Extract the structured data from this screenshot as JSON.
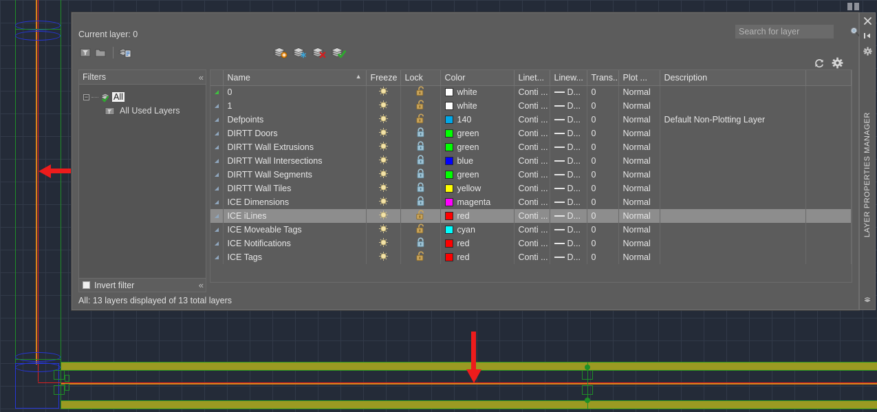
{
  "window": {
    "dock_title": "LAYER PROPERTIES MANAGER",
    "close_icon": "close-icon",
    "collapse_icon": "collapse-panel-icon",
    "settings_icon": "panel-settings-icon",
    "layers_icon": "layers-icon"
  },
  "header": {
    "current_layer_label": "Current layer: 0",
    "refresh_icon": "refresh-icon",
    "settings_icon": "gear-icon"
  },
  "search": {
    "placeholder": "Search for layer",
    "value": "",
    "icon": "search-icon"
  },
  "toolbar": {
    "left_buttons": [
      {
        "name": "new-property-filter-button",
        "icon": "filter-new-icon"
      },
      {
        "name": "new-group-filter-button",
        "icon": "folder-icon"
      },
      {
        "name": "layer-states-manager-button",
        "icon": "layer-states-icon"
      }
    ],
    "right_buttons": [
      {
        "name": "new-layer-button",
        "icon": "layer-new-icon"
      },
      {
        "name": "new-layer-vp-frozen-button",
        "icon": "layer-new-frozen-icon"
      },
      {
        "name": "delete-layer-button",
        "icon": "layer-delete-icon"
      },
      {
        "name": "set-current-button",
        "icon": "layer-set-current-icon"
      }
    ]
  },
  "filters": {
    "title": "Filters",
    "collapse_icon": "chevron-left-icon",
    "tree": [
      {
        "label": "All",
        "selected": true,
        "icon": "layers-check-icon"
      },
      {
        "label": "All Used Layers",
        "selected": false,
        "icon": "folder-used-icon"
      }
    ],
    "invert_filter_label": "Invert filter",
    "invert_filter_checked": false,
    "invert_collapse_icon": "chevron-left-icon"
  },
  "table": {
    "columns": [
      {
        "key": "status",
        "label": ""
      },
      {
        "key": "name",
        "label": "Name",
        "sorted": "asc"
      },
      {
        "key": "freeze",
        "label": "Freeze"
      },
      {
        "key": "lock",
        "label": "Lock"
      },
      {
        "key": "color",
        "label": "Color"
      },
      {
        "key": "linetype",
        "label": "Linet..."
      },
      {
        "key": "lineweight",
        "label": "Linew..."
      },
      {
        "key": "transparency",
        "label": "Trans..."
      },
      {
        "key": "plotstyle",
        "label": "Plot ..."
      },
      {
        "key": "description",
        "label": "Description"
      }
    ],
    "rows": [
      {
        "name": "0",
        "current": true,
        "freeze": "on",
        "lock": "unlocked",
        "color_name": "white",
        "color_hex": "#ffffff",
        "linetype": "Conti ...",
        "lineweight": "D...",
        "transparency": "0",
        "plotstyle": "Normal",
        "description": "",
        "selected": false
      },
      {
        "name": "1",
        "current": false,
        "freeze": "on",
        "lock": "unlocked",
        "color_name": "white",
        "color_hex": "#ffffff",
        "linetype": "Conti ...",
        "lineweight": "D...",
        "transparency": "0",
        "plotstyle": "Normal",
        "description": "",
        "selected": false
      },
      {
        "name": "Defpoints",
        "current": false,
        "freeze": "on",
        "lock": "unlocked",
        "color_name": "140",
        "color_hex": "#00a8e8",
        "linetype": "Conti ...",
        "lineweight": "D...",
        "transparency": "0",
        "plotstyle": "Normal",
        "description": "Default Non-Plotting Layer",
        "selected": false
      },
      {
        "name": "DIRTT Doors",
        "current": false,
        "freeze": "on",
        "lock": "locked",
        "color_name": "green",
        "color_hex": "#00ff00",
        "linetype": "Conti ...",
        "lineweight": "D...",
        "transparency": "0",
        "plotstyle": "Normal",
        "description": "",
        "selected": false
      },
      {
        "name": "DIRTT Wall Extrusions",
        "current": false,
        "freeze": "on",
        "lock": "locked",
        "color_name": "green",
        "color_hex": "#00ff00",
        "linetype": "Conti ...",
        "lineweight": "D...",
        "transparency": "0",
        "plotstyle": "Normal",
        "description": "",
        "selected": false
      },
      {
        "name": "DIRTT Wall Intersections",
        "current": false,
        "freeze": "on",
        "lock": "locked",
        "color_name": "blue",
        "color_hex": "#0000ff",
        "linetype": "Conti ...",
        "lineweight": "D...",
        "transparency": "0",
        "plotstyle": "Normal",
        "description": "",
        "selected": false
      },
      {
        "name": "DIRTT Wall Segments",
        "current": false,
        "freeze": "on",
        "lock": "locked",
        "color_name": "green",
        "color_hex": "#00ff00",
        "linetype": "Conti ...",
        "lineweight": "D...",
        "transparency": "0",
        "plotstyle": "Normal",
        "description": "",
        "selected": false
      },
      {
        "name": "DIRTT Wall Tiles",
        "current": false,
        "freeze": "on",
        "lock": "locked",
        "color_name": "yellow",
        "color_hex": "#ffff00",
        "linetype": "Conti ...",
        "lineweight": "D...",
        "transparency": "0",
        "plotstyle": "Normal",
        "description": "",
        "selected": false
      },
      {
        "name": "ICE Dimensions",
        "current": false,
        "freeze": "on",
        "lock": "locked",
        "color_name": "magenta",
        "color_hex": "#ff00ff",
        "linetype": "Conti ...",
        "lineweight": "D...",
        "transparency": "0",
        "plotstyle": "Normal",
        "description": "",
        "selected": false
      },
      {
        "name": "ICE iLines",
        "current": false,
        "freeze": "on",
        "lock": "unlocked",
        "color_name": "red",
        "color_hex": "#ff0000",
        "linetype": "Conti ...",
        "lineweight": "D...",
        "transparency": "0",
        "plotstyle": "Normal",
        "description": "",
        "selected": true
      },
      {
        "name": "ICE Moveable Tags",
        "current": false,
        "freeze": "on",
        "lock": "unlocked",
        "color_name": "cyan",
        "color_hex": "#00ffff",
        "linetype": "Conti ...",
        "lineweight": "D...",
        "transparency": "0",
        "plotstyle": "Normal",
        "description": "",
        "selected": false
      },
      {
        "name": "ICE Notifications",
        "current": false,
        "freeze": "on",
        "lock": "locked",
        "color_name": "red",
        "color_hex": "#ff0000",
        "linetype": "Conti ...",
        "lineweight": "D...",
        "transparency": "0",
        "plotstyle": "Normal",
        "description": "",
        "selected": false
      },
      {
        "name": "ICE Tags",
        "current": false,
        "freeze": "on",
        "lock": "unlocked",
        "color_name": "red",
        "color_hex": "#ff0000",
        "linetype": "Conti ...",
        "lineweight": "D...",
        "transparency": "0",
        "plotstyle": "Normal",
        "description": "",
        "selected": false
      }
    ]
  },
  "status": {
    "text": "All: 13 layers displayed of 13 total layers"
  },
  "annotations": [
    {
      "name": "arrow-left-ilines",
      "direction": "left"
    },
    {
      "name": "arrow-down-ilines",
      "direction": "down"
    }
  ],
  "colors": {
    "canvas_bg": "#242b38",
    "grid": "#323a49",
    "dialog_bg": "#5c5c5c",
    "selection": "#8d8d8d",
    "annotation_red": "#ed1c1c",
    "cad_green": "#1f8f27",
    "cad_orange": "#d9821a",
    "cad_blue": "#2636d8",
    "cad_olive": "#9a9a22"
  }
}
